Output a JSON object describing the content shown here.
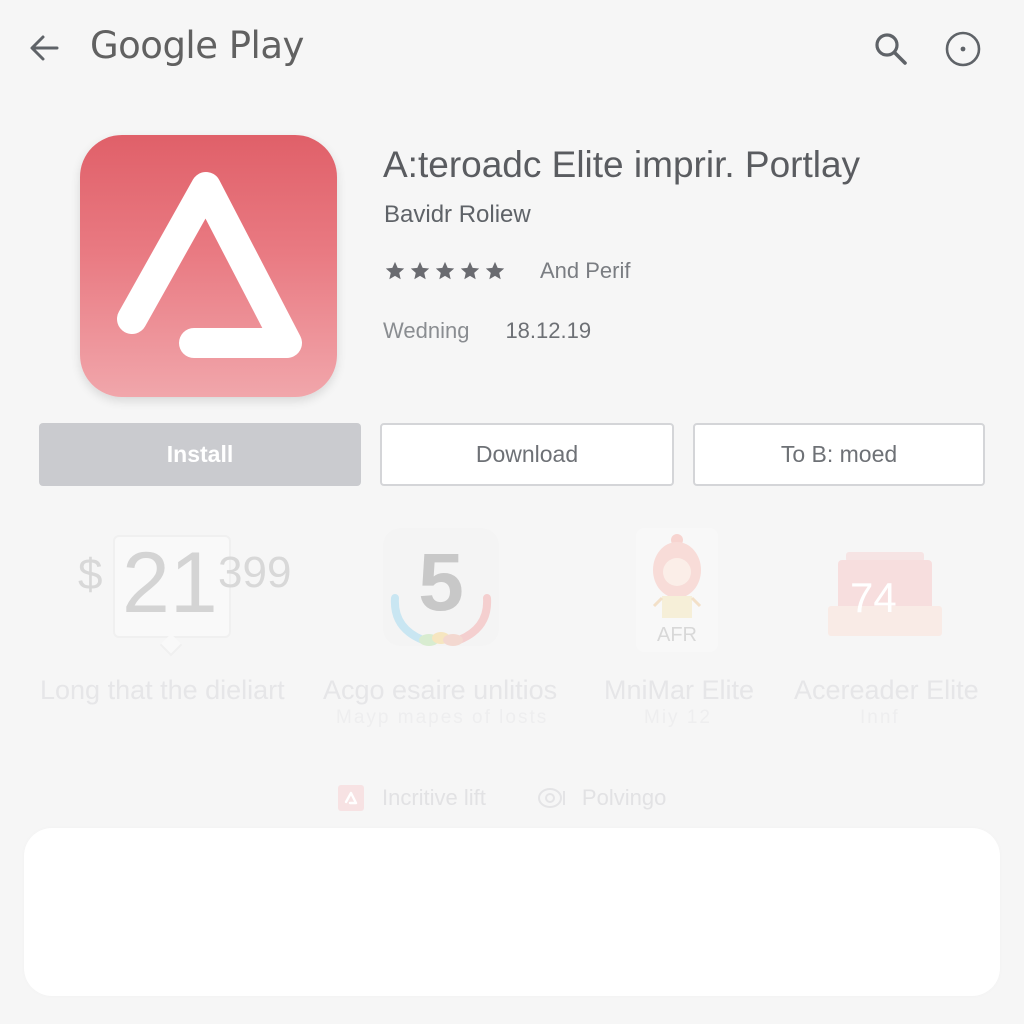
{
  "header": {
    "brand": "Google Play",
    "back_icon": "arrow-left-icon",
    "search_icon": "search-icon",
    "more_icon": "circle-dot-icon"
  },
  "app": {
    "title": "A:teroadc Elite imprir. Portlay",
    "developer": "Bavidr Roliew",
    "rating_stars": 5,
    "rating_max": 5,
    "rating_label": "And Perif",
    "meta_label": "Wedning",
    "meta_date": "18.12.19",
    "icon_colors": {
      "top": "#e06069",
      "bottom": "#f1a6ab"
    }
  },
  "actions": {
    "install": "Install",
    "download": "Download",
    "remove": "To B: moed"
  },
  "related": [
    {
      "price_symbol": "$",
      "price_main": "21",
      "price_cents": "399",
      "title": "Long that the dieliart",
      "subtitle": ""
    },
    {
      "badge": "5",
      "title": "Acgo esaire unlitios",
      "subtitle": "Mayp mapes of losts"
    },
    {
      "badge": "AFR",
      "title": "MniMar Elite",
      "subtitle": "Miy 12"
    },
    {
      "badge": "74",
      "title": "Acereader Elite",
      "subtitle": "Innf"
    }
  ],
  "chips": [
    {
      "icon": "app-logo-icon",
      "label": "Incritive lift"
    },
    {
      "icon": "eye-icon",
      "label": "Polvingo"
    }
  ],
  "colors": {
    "accent": "#e06069",
    "install_bg": "#cacbcf",
    "text_primary": "#5a5c60",
    "border": "#d4d5d8"
  }
}
